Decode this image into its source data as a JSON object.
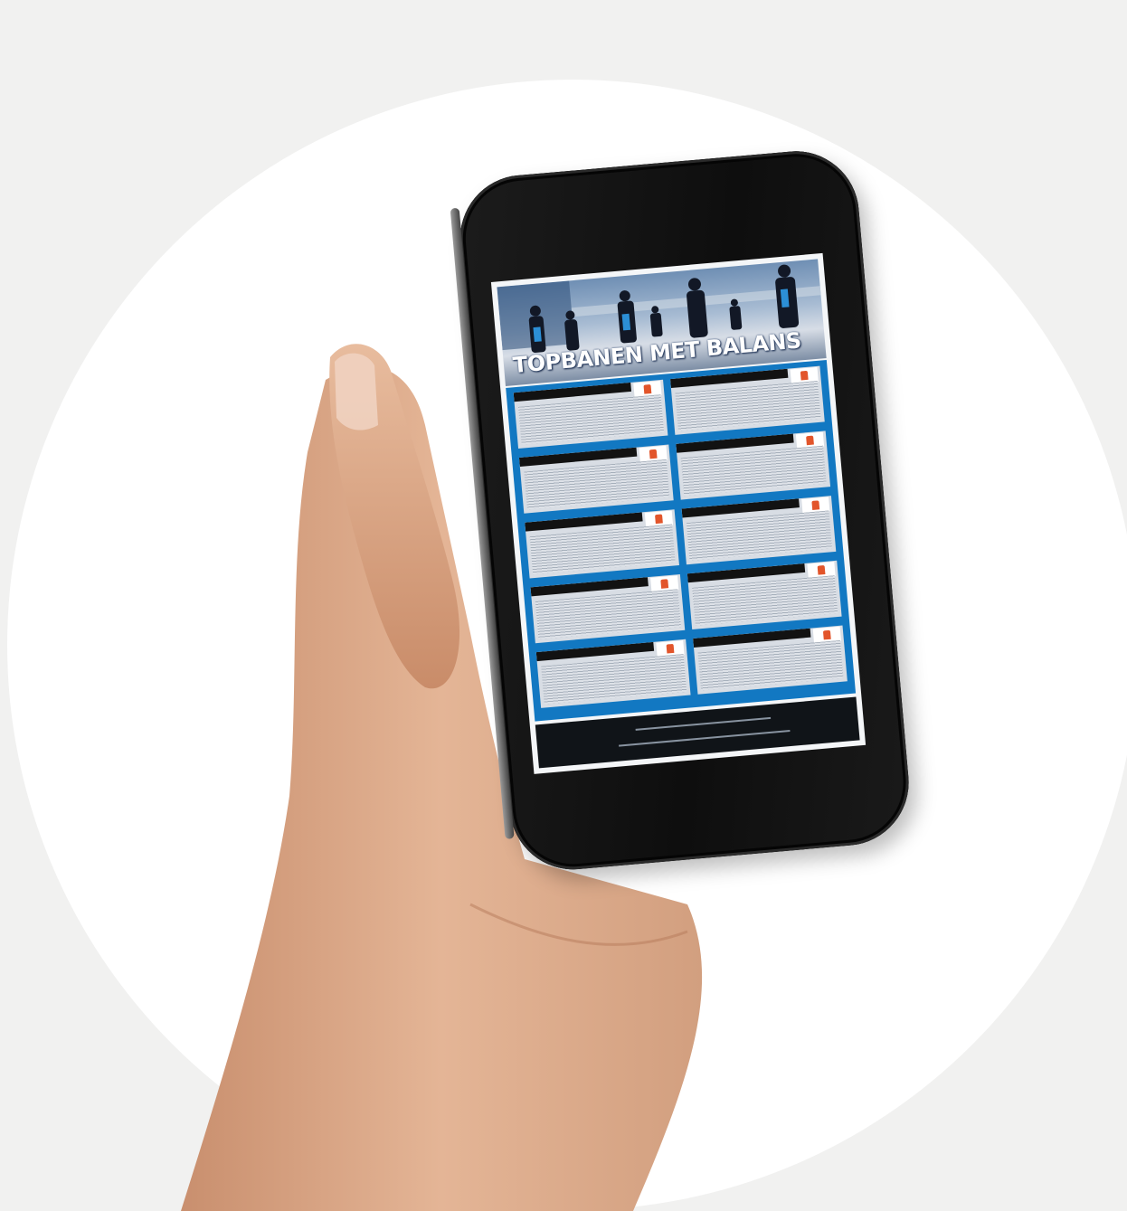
{
  "scene": {
    "background_color": "#f1f1f0",
    "circle_color": "#ffffff",
    "phone_color": "#111111",
    "accent_blue": "#1278c2"
  },
  "screen": {
    "title": "TOPBANEN MET BALANS"
  }
}
